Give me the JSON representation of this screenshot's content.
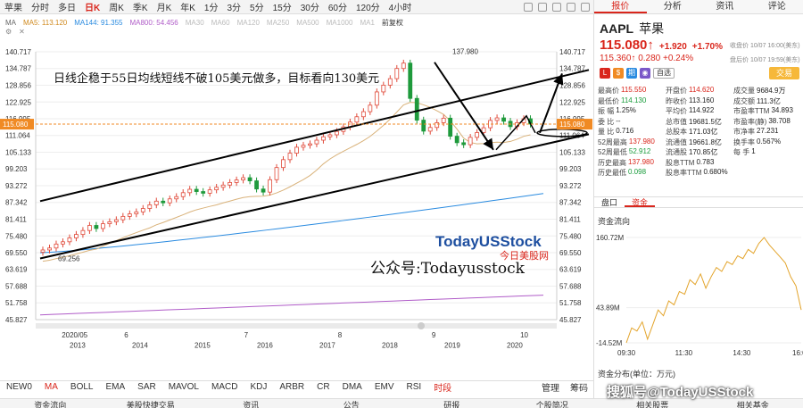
{
  "toolbar": {
    "tabs": [
      "苹果",
      "分时",
      "多日",
      "日K",
      "周K",
      "季K",
      "月K",
      "年K",
      "1分",
      "3分",
      "5分",
      "15分",
      "30分",
      "60分",
      "120分",
      "4小时"
    ],
    "active_tab": "日K"
  },
  "legend": {
    "row1": [
      "MA",
      "MA5: 113.120",
      "MA144: 91.355",
      "MA800: 54.456",
      "MA30",
      "MA60",
      "MA120",
      "MA250",
      "MA500",
      "MA1000",
      "MA1",
      "前复权"
    ],
    "row1_colors": [
      "#666",
      "#d08a1f",
      "#2a8be0",
      "#b05cc8",
      "#bbb",
      "#bbb",
      "#bbb",
      "#bbb",
      "#bbb",
      "#bbb",
      "#bbb",
      "#333"
    ]
  },
  "chart_data": {
    "type": "candlestick",
    "title": "",
    "annotation": "日线企稳于55日均线短线不破105美元做多，目标看向130美元",
    "watermark": "TodayUSStock",
    "watermark_sub": "今日美股网",
    "public_account": "公众号:Todayusstock",
    "current_price_label": "115.080",
    "high_label": "137.980",
    "low_label": "69.256",
    "y_ticks": [
      "140.717",
      "134.787",
      "128.856",
      "122.925",
      "116.995",
      "111.064",
      "105.133",
      "99.203",
      "93.272",
      "87.342",
      "81.411",
      "75.480",
      "69.550",
      "63.619",
      "57.688",
      "51.758",
      "45.827"
    ],
    "x_top_labels": [
      "2020/05",
      "6",
      "7",
      "8",
      "9",
      "10"
    ],
    "x_bottom_labels": [
      "2013",
      "2014",
      "2015",
      "2016",
      "2017",
      "2018",
      "2019",
      "2020"
    ],
    "ylim": [
      45.827,
      140.717
    ],
    "closes": [
      70.5,
      71.2,
      72.6,
      73.4,
      74.8,
      76.0,
      77.4,
      79.2,
      78.1,
      79.8,
      80.5,
      81.2,
      82.4,
      83.3,
      84.0,
      85.2,
      86.5,
      87.8,
      87.2,
      88.6,
      89.4,
      90.8,
      92.0,
      91.2,
      90.6,
      91.8,
      92.7,
      93.5,
      94.4,
      95.3,
      96.1,
      95.0,
      92.1,
      91.0,
      95.4,
      99.7,
      102.5,
      104.8,
      106.9,
      107.6,
      108.1,
      109.4,
      110.6,
      111.3,
      112.5,
      114.1,
      115.8,
      117.7,
      119.5,
      121.8,
      126.5,
      128.9,
      131.2,
      134.8,
      136.7,
      124.2,
      116.5,
      112.6,
      113.9,
      115.6,
      117.2,
      110.8,
      108.5,
      107.8,
      110.4,
      112.1,
      113.8,
      116.4,
      117.3,
      116.1,
      114.2,
      115.6,
      117.0,
      115.1
    ]
  },
  "indicators": [
    "NEW0",
    "MA",
    "BOLL",
    "EMA",
    "SAR",
    "MAVOL",
    "MACD",
    "KDJ",
    "ARBR",
    "CR",
    "DMA",
    "EMV",
    "RSI",
    "时段"
  ],
  "indicator_right": [
    "管理",
    "筹码"
  ],
  "bottom_nav": [
    "资金流向",
    "美股快捷交易",
    "资讯",
    "公告",
    "研报",
    "个股简况",
    "相关股票",
    "相关基金"
  ],
  "right_panel": {
    "tabs": [
      "报价",
      "分析",
      "资讯",
      "评论"
    ],
    "symbol": "AAPL",
    "name": "苹果",
    "price": "115.080↑",
    "change": "+1.920",
    "change_pct": "+1.70%",
    "close_note": "收盘价 10/07 16:00(美东)",
    "after_hours_price": "115.360↑",
    "after_hours_change": "0.280",
    "after_hours_pct": "+0.24%",
    "after_note": "盘后价 10/07 19:59(美东)",
    "fav_label": "自选",
    "trade_label": "交易",
    "quote_rows": [
      [
        [
          "最高价",
          "115.550"
        ],
        [
          "开盘价",
          "114.620"
        ],
        [
          "成交量",
          "9684.9万"
        ]
      ],
      [
        [
          "最低价",
          "114.130"
        ],
        [
          "昨收价",
          "113.160"
        ],
        [
          "成交额",
          "111.3亿"
        ]
      ],
      [
        [
          "振  幅",
          "1.25%"
        ],
        [
          "平均价",
          "114.922"
        ],
        [
          "市盈率TTM",
          "34.893"
        ]
      ],
      [
        [
          "委  比",
          "--"
        ],
        [
          "总市值",
          "19681.5亿"
        ],
        [
          "市盈率(静)",
          "38.708"
        ]
      ],
      [
        [
          "量  比",
          "0.716"
        ],
        [
          "总股本",
          "171.03亿"
        ],
        [
          "市净率",
          "27.231"
        ]
      ],
      [
        [
          "52周最高",
          "137.980"
        ],
        [
          "流通值",
          "19661.8亿"
        ],
        [
          "换手率",
          "0.567%"
        ]
      ],
      [
        [
          "52周最低",
          "52.912"
        ],
        [
          "流通股",
          "170.85亿"
        ],
        [
          "每  手",
          "1"
        ]
      ],
      [
        [
          "历史最高",
          "137.980"
        ],
        [
          "股息TTM",
          "0.783"
        ],
        [
          "",
          ""
        ]
      ],
      [
        [
          "历史最低",
          "0.098"
        ],
        [
          "股息率TTM",
          "0.680%"
        ],
        [
          "",
          ""
        ]
      ]
    ],
    "sub_tabs": [
      "盘口",
      "资金"
    ],
    "flow_title": "资金流向",
    "flow_y_ticks": [
      "160.72M",
      "43.89M",
      "-14.52M"
    ],
    "flow_x_ticks": [
      "09:30",
      "11:30",
      "14:30",
      "16:00"
    ],
    "flow_values": [
      -14.5,
      10.2,
      5.1,
      20.3,
      -8.4,
      15.6,
      40.1,
      30.5,
      55.2,
      48.7,
      70.8,
      66.3,
      90.4,
      82.5,
      100.1,
      76.4,
      95.3,
      110.8,
      104.2,
      120.5,
      115.7,
      130.2,
      125.6,
      140.8,
      134.3,
      150.9,
      160.7,
      148.2,
      138.4,
      128.5,
      118.4,
      95.5,
      80.3,
      40.2
    ],
    "dist_title": "资金分布(单位：万元)",
    "watermark": "搜狐号@TodayUSStock"
  }
}
